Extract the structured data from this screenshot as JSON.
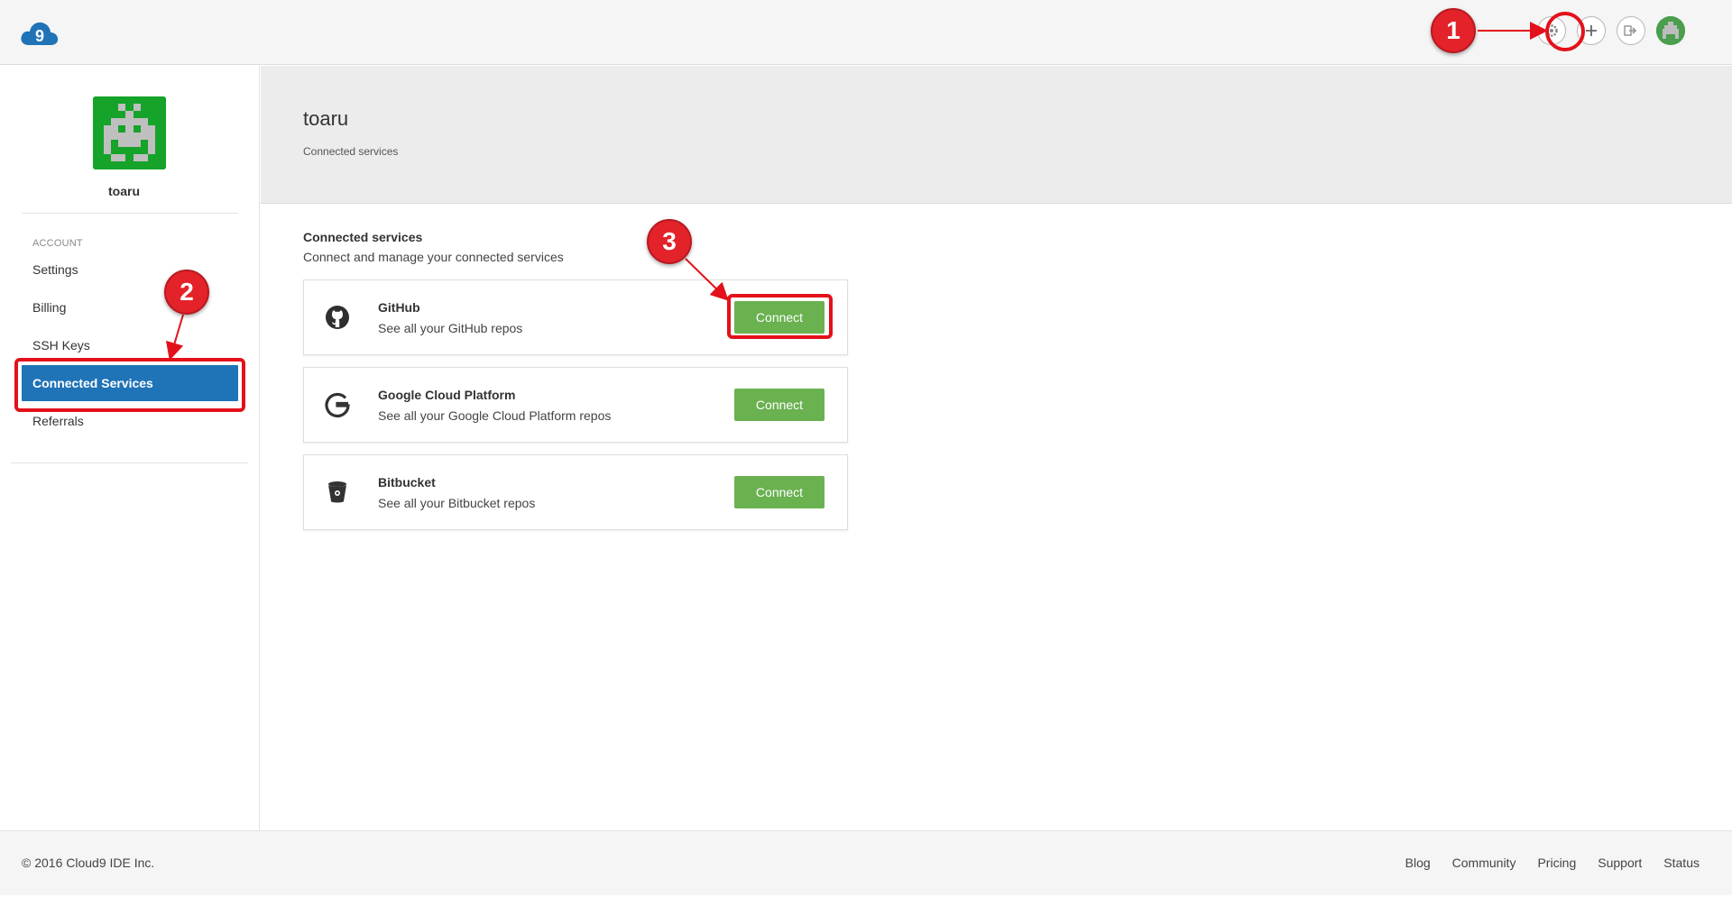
{
  "app": {
    "name": "Cloud9",
    "logo_char": "9",
    "brand_color": "#1f73b7"
  },
  "topbar": {
    "icons": [
      {
        "name": "settings",
        "glyph": "⚙"
      },
      {
        "name": "new-workspace",
        "glyph": "+"
      },
      {
        "name": "logout",
        "glyph": "➔"
      }
    ]
  },
  "profile": {
    "username": "toaru",
    "avatar_color": "#15a329"
  },
  "sidebar": {
    "section_title": "ACCOUNT",
    "items": [
      {
        "label": "Settings",
        "active": false
      },
      {
        "label": "Billing",
        "active": false
      },
      {
        "label": "SSH Keys",
        "active": false
      },
      {
        "label": "Connected Services",
        "active": true
      },
      {
        "label": "Referrals",
        "active": false
      }
    ]
  },
  "header": {
    "title": "toaru",
    "subtitle": "Connected services"
  },
  "main": {
    "heading": "Connected services",
    "description": "Connect and manage your connected services",
    "services": [
      {
        "name": "GitHub",
        "description": "See all your GitHub repos",
        "button_label": "Connect",
        "icon": "github-icon"
      },
      {
        "name": "Google Cloud Platform",
        "description": "See all your Google Cloud Platform repos",
        "button_label": "Connect",
        "icon": "google-icon"
      },
      {
        "name": "Bitbucket",
        "description": "See all your Bitbucket repos",
        "button_label": "Connect",
        "icon": "bitbucket-icon"
      }
    ],
    "button_color": "#6ab150"
  },
  "footer": {
    "copyright": "© 2016   Cloud9 IDE Inc.",
    "links": [
      "Blog",
      "Community",
      "Pricing",
      "Support",
      "Status"
    ]
  },
  "annotations": {
    "markers": [
      "1",
      "2",
      "3"
    ],
    "color": "#e3222a"
  }
}
